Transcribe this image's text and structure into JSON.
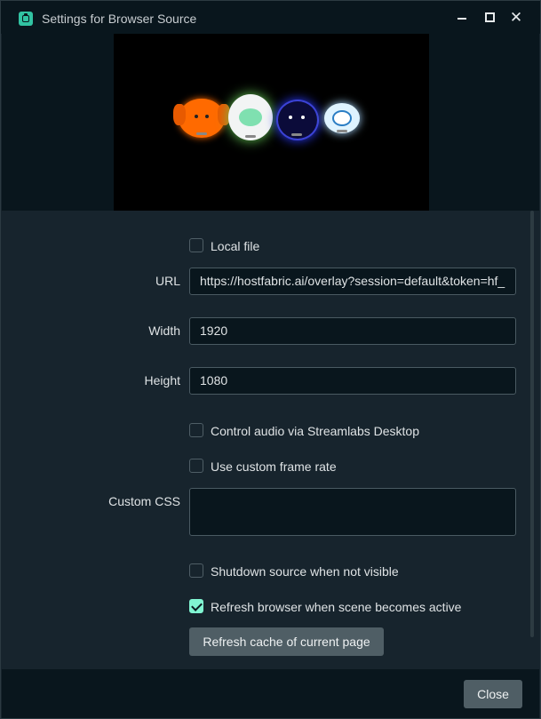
{
  "window": {
    "title": "Settings for Browser Source",
    "app_icon": "streamlabs-icon",
    "controls": {
      "minimize": "minimize-icon",
      "maximize": "maximize-icon",
      "close": "✕"
    }
  },
  "preview": {
    "background": "#000000",
    "content": "mascot-overlay"
  },
  "form": {
    "local_file": {
      "label": "Local file",
      "checked": false
    },
    "url": {
      "label": "URL",
      "value": "https://hostfabric.ai/overlay?session=default&token=hf_"
    },
    "width": {
      "label": "Width",
      "value": "1920"
    },
    "height": {
      "label": "Height",
      "value": "1080"
    },
    "control_audio": {
      "label": "Control audio via Streamlabs Desktop",
      "checked": false
    },
    "custom_frame_rate": {
      "label": "Use custom frame rate",
      "checked": false
    },
    "custom_css": {
      "label": "Custom CSS",
      "value": ""
    },
    "shutdown_source": {
      "label": "Shutdown source when not visible",
      "checked": false
    },
    "refresh_browser": {
      "label": "Refresh browser when scene becomes active",
      "checked": true
    },
    "refresh_cache_button": "Refresh cache of current page"
  },
  "footer": {
    "close_button": "Close"
  },
  "colors": {
    "accent": "#80f5d2",
    "panel": "#17242d",
    "dark": "#09161d",
    "button": "#4f5e65"
  }
}
